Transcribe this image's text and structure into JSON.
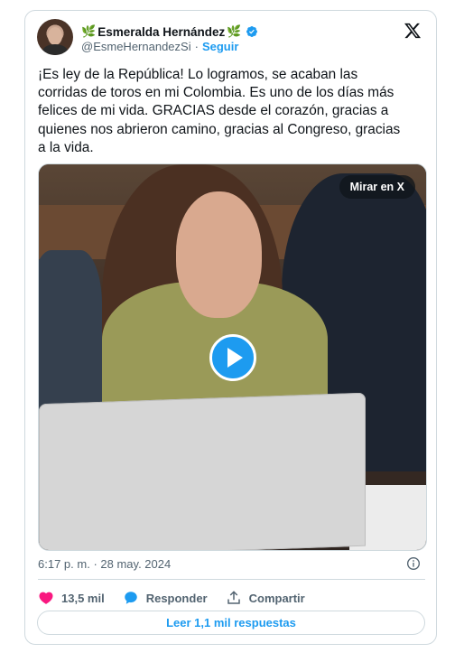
{
  "author": {
    "display_name": "Esmeralda Hernández",
    "leaf_emoji": "🌿",
    "handle": "@EsmeHernandezSi",
    "separator": "·",
    "follow_label": "Seguir",
    "verified": true
  },
  "tweet": {
    "text": "¡Es ley de la República! Lo logramos, se acaban las\ncorridas de toros en mi Colombia. Es uno de los días más\nfelices de mi vida. GRACIAS desde el corazón, gracias a\nquienes nos abrieron camino, gracias al Congreso, gracias\na la vida."
  },
  "media": {
    "overlay_label": "Mirar en X",
    "type": "video"
  },
  "meta": {
    "time": "6:17 p. m.",
    "separator": "·",
    "date": "28 may. 2024"
  },
  "actions": {
    "likes": "13,5 mil",
    "reply_label": "Responder",
    "share_label": "Compartir"
  },
  "replies_button": "Leer 1,1 mil respuestas",
  "colors": {
    "accent": "#1d9bf0",
    "like": "#f91880",
    "text": "#0f1419",
    "muted": "#536471",
    "border": "#cfd9de"
  }
}
